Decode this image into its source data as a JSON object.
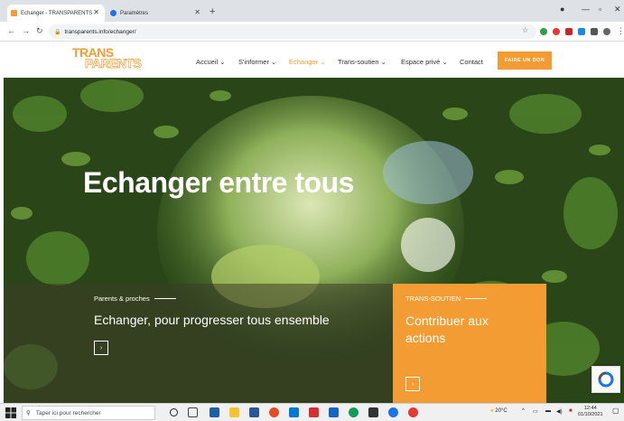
{
  "browser": {
    "tabs": [
      {
        "title": "Echanger - TRANSPARENTS",
        "favicon": "transparents-favicon-icon",
        "active": true
      },
      {
        "title": "Paramètres",
        "favicon": "settings-gear-icon",
        "active": false
      }
    ],
    "url": "transparents.info/echanger/",
    "colors": {
      "tabbar": "#dee1e6",
      "omnibox": "#f1f3f4"
    }
  },
  "site": {
    "logo": {
      "line1": "TRANS",
      "line2": "PARENTS"
    },
    "menu": [
      {
        "label": "Accueil",
        "has_dropdown": true,
        "active": false
      },
      {
        "label": "S'informer",
        "has_dropdown": true,
        "active": false
      },
      {
        "label": "Echanger",
        "has_dropdown": true,
        "active": true
      },
      {
        "label": "Trans-soutien",
        "has_dropdown": true,
        "active": false
      },
      {
        "label": "Espace privé",
        "has_dropdown": true,
        "active": false
      },
      {
        "label": "Contact",
        "has_dropdown": false,
        "active": false
      }
    ],
    "cta": "FAIRE UN DON",
    "accent_color": "#f39c34"
  },
  "hero": {
    "title": "Echanger entre tous",
    "left_panel": {
      "eyebrow": "Parents & proches",
      "title": "Echanger, pour progresser tous ensemble"
    },
    "right_panel": {
      "eyebrow": "TRANS-SOUTIEN",
      "title_line1": "Contribuer aux",
      "title_line2": "actions"
    }
  },
  "taskbar": {
    "search_placeholder": "Taper ici pour rechercher",
    "weather": "20°C",
    "time": "12:44",
    "date": "01/10/2021"
  }
}
